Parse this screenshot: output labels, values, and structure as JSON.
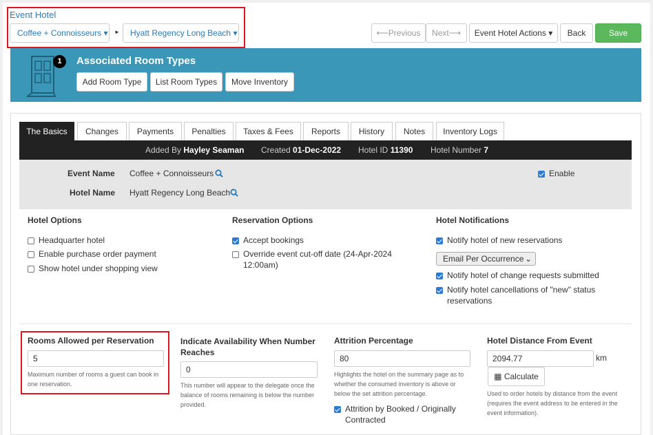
{
  "header": {
    "title": "Event Hotel",
    "event_dropdown": "Coffee + Connoisseurs",
    "hotel_dropdown": "Hyatt Regency Long Beach",
    "separator": "►"
  },
  "toolbar": {
    "previous": "⟵Previous",
    "next": "Next⟶",
    "actions": "Event Hotel Actions",
    "back": "Back",
    "save": "Save"
  },
  "banner": {
    "badge": "1",
    "title": "Associated Room Types",
    "buttons": [
      "Add Room Type",
      "List Room Types",
      "Move Inventory"
    ]
  },
  "tabs": [
    "The Basics",
    "Changes",
    "Payments",
    "Penalties",
    "Taxes & Fees",
    "Reports",
    "History",
    "Notes",
    "Inventory Logs"
  ],
  "info": {
    "added_by_label": "Added By",
    "added_by": "Hayley Seaman",
    "created_label": "Created",
    "created": "01-Dec-2022",
    "hotel_id_label": "Hotel ID",
    "hotel_id": "11390",
    "hotel_number_label": "Hotel Number",
    "hotel_number": "7"
  },
  "basics": {
    "event_name_label": "Event Name",
    "event_name": "Coffee + Connoisseurs",
    "hotel_name_label": "Hotel Name",
    "hotel_name": "Hyatt Regency Long Beach",
    "enable_label": "Enable",
    "enable_checked": true
  },
  "hotel_options": {
    "title": "Hotel Options",
    "items": [
      {
        "label": "Headquarter hotel",
        "checked": false
      },
      {
        "label": "Enable purchase order payment",
        "checked": false
      },
      {
        "label": "Show hotel under shopping view",
        "checked": false
      }
    ]
  },
  "reservation_options": {
    "title": "Reservation Options",
    "items": [
      {
        "label": "Accept bookings",
        "checked": true
      },
      {
        "label": "Override event cut-off date (24-Apr-2024 12:00am)",
        "checked": false
      }
    ]
  },
  "notifications": {
    "title": "Hotel Notifications",
    "items": [
      {
        "label": "Notify hotel of new reservations",
        "checked": true
      },
      {
        "label": "Notify hotel of change requests submitted",
        "checked": true
      },
      {
        "label": "Notify hotel cancellations of \"new\" status reservations",
        "checked": true
      }
    ],
    "frequency": "Email Per Occurrence"
  },
  "fields": {
    "rooms": {
      "label": "Rooms Allowed per Reservation",
      "value": "5",
      "help": "Maximum number of rooms a guest can book in one reservation."
    },
    "availability": {
      "label": "Indicate Availability When Number Reaches",
      "value": "0",
      "help": "This number will appear to the delegate once the balance of rooms remaining is below the number provided."
    },
    "attrition": {
      "label": "Attrition Percentage",
      "value": "80",
      "help": "Highlights the hotel on the summary page as to whether the consumed inventory is above or below the set attrition percentage.",
      "checkbox_label": "Attrition by Booked / Originally Contracted",
      "checkbox_checked": true
    },
    "distance": {
      "label": "Hotel Distance From Event",
      "value": "2094.77",
      "unit": "km",
      "calc": "Calculate",
      "help": "Used to order hotels by distance from the event (requires the event address to be entered in the event information)."
    }
  },
  "colors": {
    "accent": "#2a7ab8",
    "banner": "#3b97b8",
    "save": "#5cb85c",
    "highlight": "#e0151c"
  }
}
